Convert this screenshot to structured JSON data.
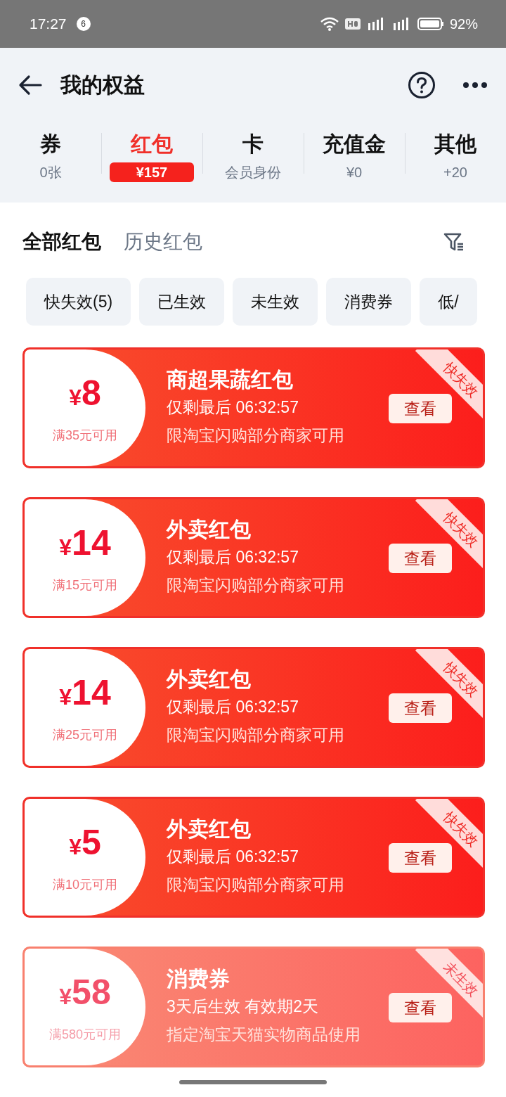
{
  "status_bar": {
    "time": "17:27",
    "notification_count": "6",
    "battery": "92%"
  },
  "header": {
    "title": "我的权益"
  },
  "categories": [
    {
      "label": "券",
      "value": "0张",
      "selected": false
    },
    {
      "label": "红包",
      "value": "¥157",
      "selected": true
    },
    {
      "label": "卡",
      "value": "会员身份",
      "selected": false
    },
    {
      "label": "充值金",
      "value": "¥0",
      "selected": false
    },
    {
      "label": "其他",
      "value": "+20",
      "selected": false
    }
  ],
  "tabs": [
    {
      "label": "全部红包",
      "selected": true
    },
    {
      "label": "历史红包",
      "selected": false
    }
  ],
  "filters": [
    "快失效(5)",
    "已生效",
    "未生效",
    "消费券",
    "低/"
  ],
  "coupons": [
    {
      "kind": "expiring",
      "currency": "¥",
      "amount": "8",
      "condition": "满35元可用",
      "title": "商超果蔬红包",
      "time_line": "仅剩最后 06:32:57",
      "scope": "限淘宝闪购部分商家可用",
      "button": "查看",
      "badge": "快失效"
    },
    {
      "kind": "expiring",
      "currency": "¥",
      "amount": "14",
      "condition": "满15元可用",
      "title": "外卖红包",
      "time_line": "仅剩最后 06:32:57",
      "scope": "限淘宝闪购部分商家可用",
      "button": "查看",
      "badge": "快失效"
    },
    {
      "kind": "expiring",
      "currency": "¥",
      "amount": "14",
      "condition": "满25元可用",
      "title": "外卖红包",
      "time_line": "仅剩最后 06:32:57",
      "scope": "限淘宝闪购部分商家可用",
      "button": "查看",
      "badge": "快失效"
    },
    {
      "kind": "expiring",
      "currency": "¥",
      "amount": "5",
      "condition": "满10元可用",
      "title": "外卖红包",
      "time_line": "仅剩最后 06:32:57",
      "scope": "限淘宝闪购部分商家可用",
      "button": "查看",
      "badge": "快失效"
    },
    {
      "kind": "pending",
      "currency": "¥",
      "amount": "58",
      "condition": "满580元可用",
      "title": "消费券",
      "time_line": "3天后生效 有效期2天",
      "scope": "指定淘宝天猫实物商品使用",
      "button": "查看",
      "badge": "未生效"
    }
  ]
}
